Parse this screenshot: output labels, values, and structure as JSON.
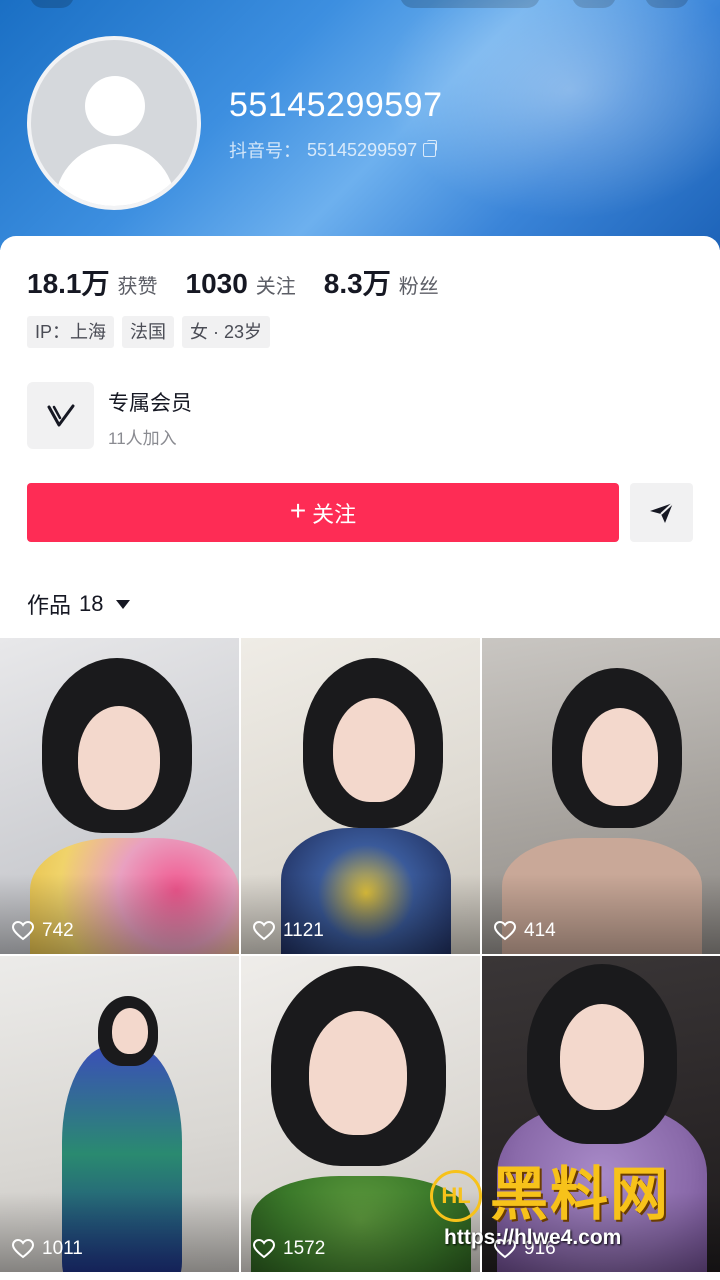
{
  "profile": {
    "username": "55145299597",
    "douyin_id_label": "抖音号：",
    "douyin_id": "55145299597"
  },
  "stats": [
    {
      "value": "18.1万",
      "label": "获赞"
    },
    {
      "value": "1030",
      "label": "关注"
    },
    {
      "value": "8.3万",
      "label": "粉丝"
    }
  ],
  "tags": [
    "IP：上海",
    "法国",
    "女 · 23岁"
  ],
  "membership": {
    "title": "专属会员",
    "subtitle": "11人加入",
    "icon": "v-badge-icon"
  },
  "actions": {
    "follow_label": "关注",
    "follow_icon": "plus-icon",
    "share_icon": "send-icon"
  },
  "works": {
    "label": "作品",
    "count": "18"
  },
  "videos": [
    {
      "likes": "742"
    },
    {
      "likes": "1121"
    },
    {
      "likes": "414"
    },
    {
      "likes": "1011"
    },
    {
      "likes": "1572"
    },
    {
      "likes": "916"
    }
  ],
  "watermark": {
    "title": "黑料网",
    "url": "https://hlwe4.com",
    "logo_text": "HL"
  },
  "colors": {
    "accent": "#fe2c55",
    "header_blue": "#3d8fe0",
    "watermark_gold": "#f7c21a"
  }
}
